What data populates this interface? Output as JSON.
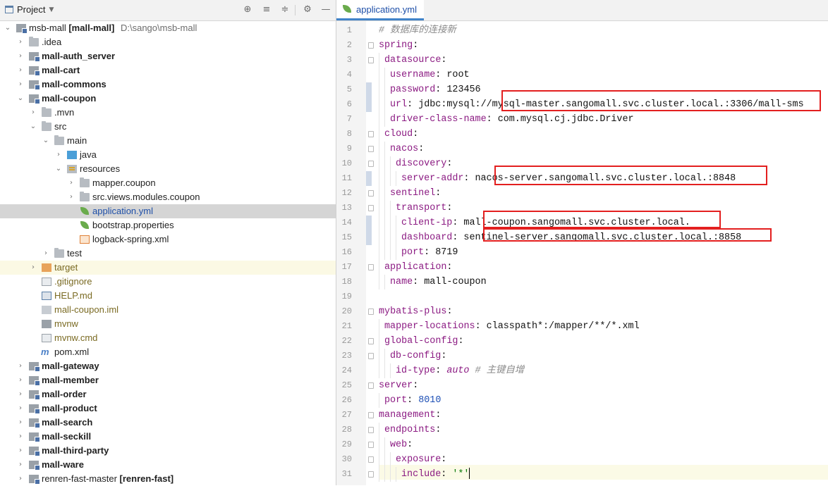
{
  "project_panel": {
    "title": "Project",
    "dropdown_icon": "chevron-down-icon",
    "toolbar_icons": [
      "locate-icon",
      "expand-all-icon",
      "collapse-all-icon",
      "gear-icon",
      "minimize-icon"
    ],
    "tree": [
      {
        "label": "msb-mall",
        "bold_suffix": " [mall-mall]",
        "path": "D:\\sango\\msb-mall",
        "bold": false,
        "expanded": true
      },
      {
        "label": ".idea"
      },
      {
        "label": "mall-auth_server"
      },
      {
        "label": "mall-cart"
      },
      {
        "label": "mall-commons"
      },
      {
        "label": "mall-coupon"
      },
      {
        "label": ".mvn"
      },
      {
        "label": "src"
      },
      {
        "label": "main"
      },
      {
        "label": "java"
      },
      {
        "label": "resources"
      },
      {
        "label": "mapper.coupon"
      },
      {
        "label": "src.views.modules.coupon"
      },
      {
        "label": "application.yml"
      },
      {
        "label": "bootstrap.properties"
      },
      {
        "label": "logback-spring.xml"
      },
      {
        "label": "test"
      },
      {
        "label": "target"
      },
      {
        "label": ".gitignore"
      },
      {
        "label": "HELP.md"
      },
      {
        "label": "mall-coupon.iml"
      },
      {
        "label": "mvnw"
      },
      {
        "label": "mvnw.cmd"
      },
      {
        "label": "pom.xml"
      },
      {
        "label": "mall-gateway"
      },
      {
        "label": "mall-member"
      },
      {
        "label": "mall-order"
      },
      {
        "label": "mall-product"
      },
      {
        "label": "mall-search"
      },
      {
        "label": "mall-seckill"
      },
      {
        "label": "mall-third-party"
      },
      {
        "label": "mall-ware"
      },
      {
        "label": "renren-fast-master",
        "bold_suffix": " [renren-fast]"
      }
    ]
  },
  "editor": {
    "tab_label": "application.yml",
    "line_numbers": [
      "1",
      "2",
      "3",
      "4",
      "5",
      "6",
      "7",
      "8",
      "9",
      "10",
      "11",
      "12",
      "13",
      "14",
      "15",
      "16",
      "17",
      "18",
      "19",
      "20",
      "21",
      "22",
      "23",
      "24",
      "25",
      "26",
      "27",
      "28",
      "29",
      "30",
      "31"
    ],
    "lines": {
      "l1_comment": "# 数据库的连接新",
      "l2_key": "spring",
      "l3_key": "datasource",
      "l4_key": "username",
      "l4_val": "root",
      "l5_key": "password",
      "l5_val": "123456",
      "l6_key": "url",
      "l6_val": "jdbc:mysql://mysql-master.sangomall.svc.cluster.local.:3306/mall-sms",
      "l7_key": "driver-class-name",
      "l7_val": "com.mysql.cj.jdbc.Driver",
      "l8_key": "cloud",
      "l9_key": "nacos",
      "l10_key": "discovery",
      "l11_key": "server-addr",
      "l11_val": "nacos-server.sangomall.svc.cluster.local.:8848",
      "l12_key": "sentinel",
      "l13_key": "transport",
      "l14_key": "client-ip",
      "l14_val": "mall-coupon.sangomall.svc.cluster.local.",
      "l15_key": "dashboard",
      "l15_val": "sentinel-server.sangomall.svc.cluster.local.:8858",
      "l16_key": "port",
      "l16_val": "8719",
      "l17_key": "application",
      "l18_key": "name",
      "l18_val": "mall-coupon",
      "l20_key": "mybatis-plus",
      "l21_key": "mapper-locations",
      "l21_val": "classpath*:/mapper/**/*.xml",
      "l22_key": "global-config",
      "l23_key": "db-config",
      "l24_key": "id-type",
      "l24_val": "auto",
      "l24_comment": "# 主键自增",
      "l25_key": "server",
      "l26_key": "port",
      "l26_val": "8010",
      "l27_key": "management",
      "l28_key": "endpoints",
      "l29_key": "web",
      "l30_key": "exposure",
      "l31_key": "include",
      "l31_val": "'*'"
    }
  },
  "colors": {
    "annotation_box": "#e31f1f",
    "selected_row": "#d5d5d5",
    "key_color": "#8b1a82",
    "number_color": "#1d4fb5"
  }
}
